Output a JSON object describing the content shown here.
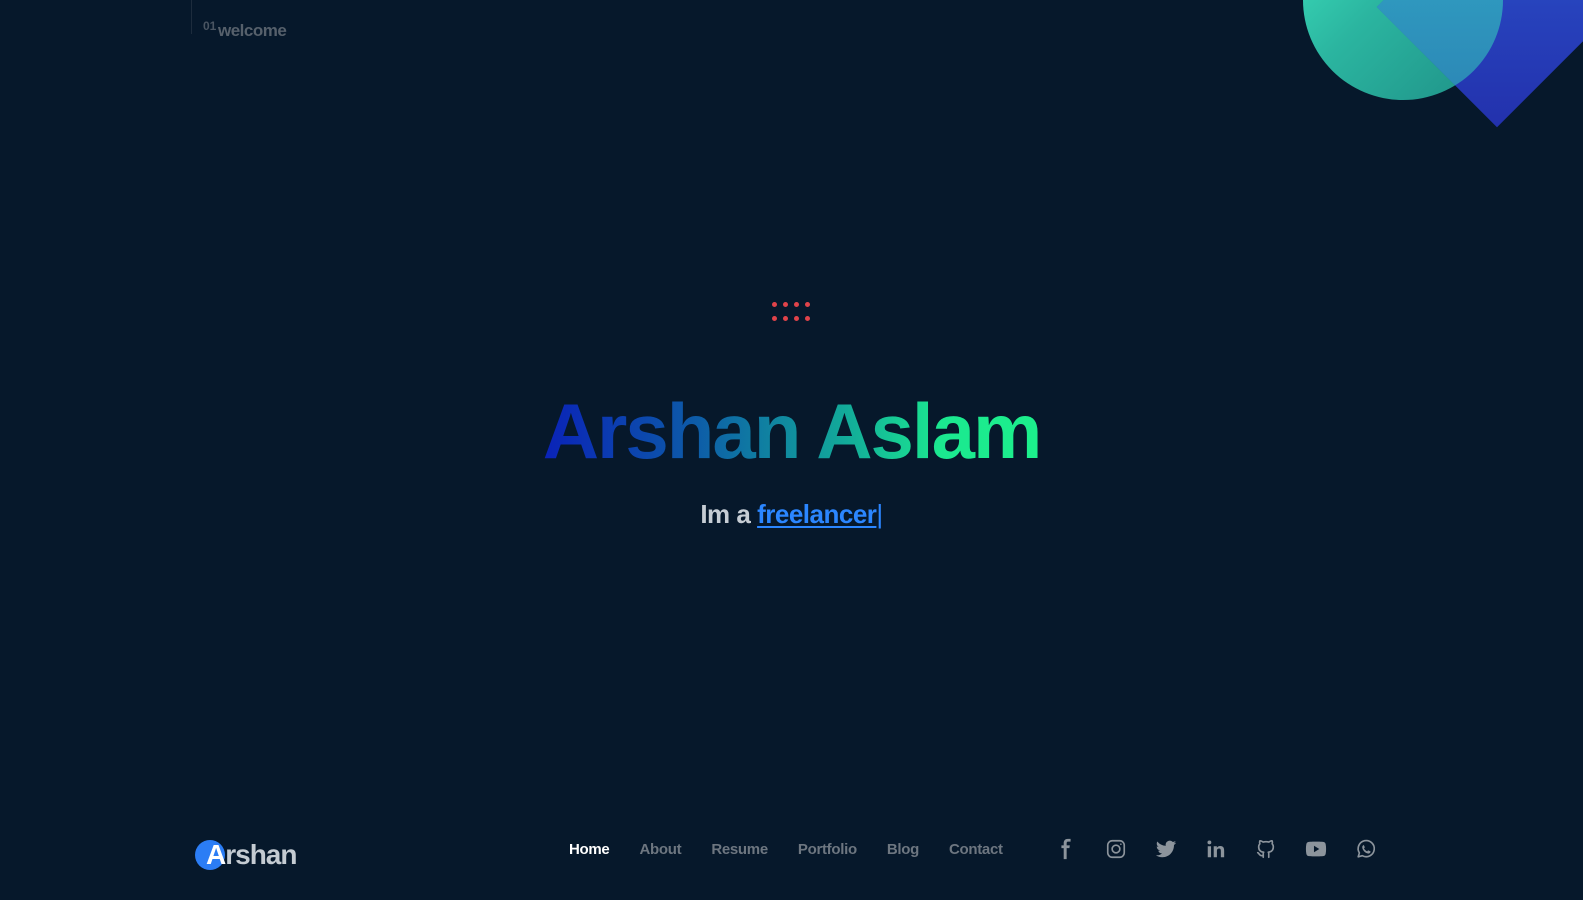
{
  "section": {
    "number": "01",
    "label": "welcome"
  },
  "hero": {
    "name": "Arshan Aslam",
    "tagline_prefix": "Im a",
    "tagline_role": "freelancer",
    "cursor": "|"
  },
  "brand": {
    "logo_initial": "A",
    "logo_rest": "rshan"
  },
  "nav": {
    "items": [
      {
        "label": "Home",
        "active": true
      },
      {
        "label": "About"
      },
      {
        "label": "Resume"
      },
      {
        "label": "Portfolio"
      },
      {
        "label": "Blog"
      },
      {
        "label": "Contact"
      }
    ]
  },
  "social": {
    "icons": [
      "facebook-icon",
      "instagram-icon",
      "twitter-icon",
      "linkedin-icon",
      "github-icon",
      "youtube-icon",
      "whatsapp-icon"
    ]
  },
  "colors": {
    "background": "#06182b",
    "accent_blue": "#2b86ff",
    "dots_red": "#e0434a",
    "gradient_start": "#0a22b8",
    "gradient_end": "#1cf08c"
  }
}
